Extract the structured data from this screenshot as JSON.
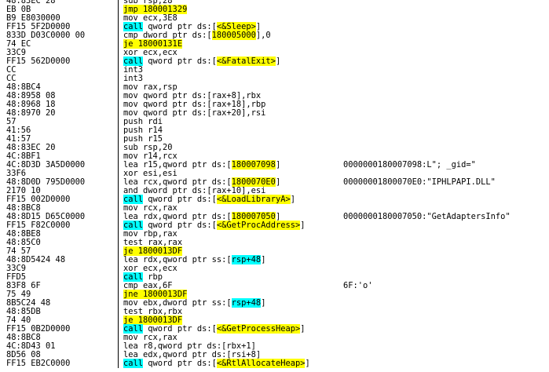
{
  "rows": [
    {
      "bytes": "48:83EC 28",
      "instr": [
        [
          "sub rsp,28",
          "plain"
        ]
      ],
      "comment": ""
    },
    {
      "bytes": "EB 0B",
      "instr": [
        [
          "jmp 180001329",
          "jmp"
        ]
      ],
      "comment": ""
    },
    {
      "bytes": "B9 E8030000",
      "instr": [
        [
          "mov ecx,3E8",
          "plain"
        ]
      ],
      "comment": ""
    },
    {
      "bytes": "FF15 5F2D0000",
      "instr": [
        [
          "call",
          "call"
        ],
        [
          " qword ptr ds:[",
          "plain"
        ],
        [
          "<&Sleep>",
          "sym"
        ],
        [
          "]",
          "plain"
        ]
      ],
      "comment": ""
    },
    {
      "bytes": "833D D03C0000 00",
      "instr": [
        [
          "cmp dword ptr ds:[",
          "plain"
        ],
        [
          "180005000",
          "addr"
        ],
        [
          "],0",
          "plain"
        ]
      ],
      "comment": ""
    },
    {
      "bytes": "74 EC",
      "instr": [
        [
          "je 18000131E",
          "jmp"
        ]
      ],
      "comment": ""
    },
    {
      "bytes": "33C9",
      "instr": [
        [
          "xor ecx,ecx",
          "plain"
        ]
      ],
      "comment": ""
    },
    {
      "bytes": "FF15 562D0000",
      "instr": [
        [
          "call",
          "call"
        ],
        [
          " qword ptr ds:[",
          "plain"
        ],
        [
          "<&FatalExit>",
          "sym"
        ],
        [
          "]",
          "plain"
        ]
      ],
      "comment": ""
    },
    {
      "bytes": "CC",
      "instr": [
        [
          "int3",
          "plain"
        ]
      ],
      "comment": ""
    },
    {
      "bytes": "CC",
      "instr": [
        [
          "int3",
          "plain"
        ]
      ],
      "comment": ""
    },
    {
      "bytes": "48:8BC4",
      "instr": [
        [
          "mov rax,rsp",
          "plain"
        ]
      ],
      "comment": ""
    },
    {
      "bytes": "48:8958 08",
      "instr": [
        [
          "mov qword ptr ds:[rax+8],rbx",
          "plain"
        ]
      ],
      "comment": ""
    },
    {
      "bytes": "48:8968 18",
      "instr": [
        [
          "mov qword ptr ds:[rax+18],rbp",
          "plain"
        ]
      ],
      "comment": ""
    },
    {
      "bytes": "48:8970 20",
      "instr": [
        [
          "mov qword ptr ds:[rax+20],rsi",
          "plain"
        ]
      ],
      "comment": ""
    },
    {
      "bytes": "57",
      "instr": [
        [
          "push rdi",
          "plain"
        ]
      ],
      "comment": ""
    },
    {
      "bytes": "41:56",
      "instr": [
        [
          "push r14",
          "plain"
        ]
      ],
      "comment": ""
    },
    {
      "bytes": "41:57",
      "instr": [
        [
          "push r15",
          "plain"
        ]
      ],
      "comment": ""
    },
    {
      "bytes": "48:83EC 20",
      "instr": [
        [
          "sub rsp,20",
          "plain"
        ]
      ],
      "comment": ""
    },
    {
      "bytes": "4C:8BF1",
      "instr": [
        [
          "mov r14,rcx",
          "plain"
        ]
      ],
      "comment": ""
    },
    {
      "bytes": "4C:8D3D 3A5D0000",
      "instr": [
        [
          "lea r15,qword ptr ds:[",
          "plain"
        ],
        [
          "180007098",
          "addr"
        ],
        [
          "]",
          "plain"
        ]
      ],
      "comment": "0000000180007098:L\"; _gid=\""
    },
    {
      "bytes": "33F6",
      "instr": [
        [
          "xor esi,esi",
          "plain"
        ]
      ],
      "comment": ""
    },
    {
      "bytes": "48:8D0D 795D0000",
      "instr": [
        [
          "lea rcx,qword ptr ds:[",
          "plain"
        ],
        [
          "1800070E0",
          "addr"
        ],
        [
          "]",
          "plain"
        ]
      ],
      "comment": "00000001800070E0:\"IPHLPAPI.DLL\""
    },
    {
      "bytes": "2170 10",
      "instr": [
        [
          "and dword ptr ds:[rax+10],esi",
          "plain"
        ]
      ],
      "comment": ""
    },
    {
      "bytes": "FF15 002D0000",
      "instr": [
        [
          "call",
          "call"
        ],
        [
          " qword ptr ds:[",
          "plain"
        ],
        [
          "<&LoadLibraryA>",
          "sym"
        ],
        [
          "]",
          "plain"
        ]
      ],
      "comment": ""
    },
    {
      "bytes": "48:8BC8",
      "instr": [
        [
          "mov rcx,rax",
          "plain"
        ]
      ],
      "comment": ""
    },
    {
      "bytes": "48:8D15 D65C0000",
      "instr": [
        [
          "lea rdx,qword ptr ds:[",
          "plain"
        ],
        [
          "180007050",
          "addr"
        ],
        [
          "]",
          "plain"
        ]
      ],
      "comment": "0000000180007050:\"GetAdaptersInfo\""
    },
    {
      "bytes": "FF15 F82C0000",
      "instr": [
        [
          "call",
          "call"
        ],
        [
          " qword ptr ds:[",
          "plain"
        ],
        [
          "<&GetProcAddress>",
          "sym"
        ],
        [
          "]",
          "plain"
        ]
      ],
      "comment": ""
    },
    {
      "bytes": "48:8BE8",
      "instr": [
        [
          "mov rbp,rax",
          "plain"
        ]
      ],
      "comment": ""
    },
    {
      "bytes": "48:85C0",
      "instr": [
        [
          "test rax,rax",
          "plain"
        ]
      ],
      "comment": ""
    },
    {
      "bytes": "74 57",
      "instr": [
        [
          "je 1800013DF",
          "jmp"
        ]
      ],
      "comment": ""
    },
    {
      "bytes": "48:8D5424 48",
      "instr": [
        [
          "lea rdx,qword ptr ss:[",
          "plain"
        ],
        [
          "rsp+48",
          "ss"
        ],
        [
          "]",
          "plain"
        ]
      ],
      "comment": ""
    },
    {
      "bytes": "33C9",
      "instr": [
        [
          "xor ecx,ecx",
          "plain"
        ]
      ],
      "comment": ""
    },
    {
      "bytes": "FFD5",
      "instr": [
        [
          "call",
          "call"
        ],
        [
          " rbp",
          "plain"
        ]
      ],
      "comment": ""
    },
    {
      "bytes": "83F8 6F",
      "instr": [
        [
          "cmp eax,6F",
          "plain"
        ]
      ],
      "comment": "6F:'o'"
    },
    {
      "bytes": "75 49",
      "instr": [
        [
          "jne 1800013DF",
          "jmp"
        ]
      ],
      "comment": ""
    },
    {
      "bytes": "8B5C24 48",
      "instr": [
        [
          "mov ebx,dword ptr ss:[",
          "plain"
        ],
        [
          "rsp+48",
          "ss"
        ],
        [
          "]",
          "plain"
        ]
      ],
      "comment": ""
    },
    {
      "bytes": "48:85DB",
      "instr": [
        [
          "test rbx,rbx",
          "plain"
        ]
      ],
      "comment": ""
    },
    {
      "bytes": "74 40",
      "instr": [
        [
          "je 1800013DF",
          "jmp"
        ]
      ],
      "comment": ""
    },
    {
      "bytes": "FF15 0B2D0000",
      "instr": [
        [
          "call",
          "call"
        ],
        [
          " qword ptr ds:[",
          "plain"
        ],
        [
          "<&GetProcessHeap>",
          "sym"
        ],
        [
          "]",
          "plain"
        ]
      ],
      "comment": ""
    },
    {
      "bytes": "48:8BC8",
      "instr": [
        [
          "mov rcx,rax",
          "plain"
        ]
      ],
      "comment": ""
    },
    {
      "bytes": "4C:8D43 01",
      "instr": [
        [
          "lea r8,qword ptr ds:[rbx+1]",
          "plain"
        ]
      ],
      "comment": ""
    },
    {
      "bytes": "8D56 08",
      "instr": [
        [
          "lea edx,qword ptr ds:[rsi+8]",
          "plain"
        ]
      ],
      "comment": ""
    },
    {
      "bytes": "FF15 EB2C0000",
      "instr": [
        [
          "call",
          "call"
        ],
        [
          " qword ptr ds:[",
          "plain"
        ],
        [
          "<&RtlAllocateHeap>",
          "sym"
        ],
        [
          "]",
          "plain"
        ]
      ],
      "comment": ""
    }
  ]
}
